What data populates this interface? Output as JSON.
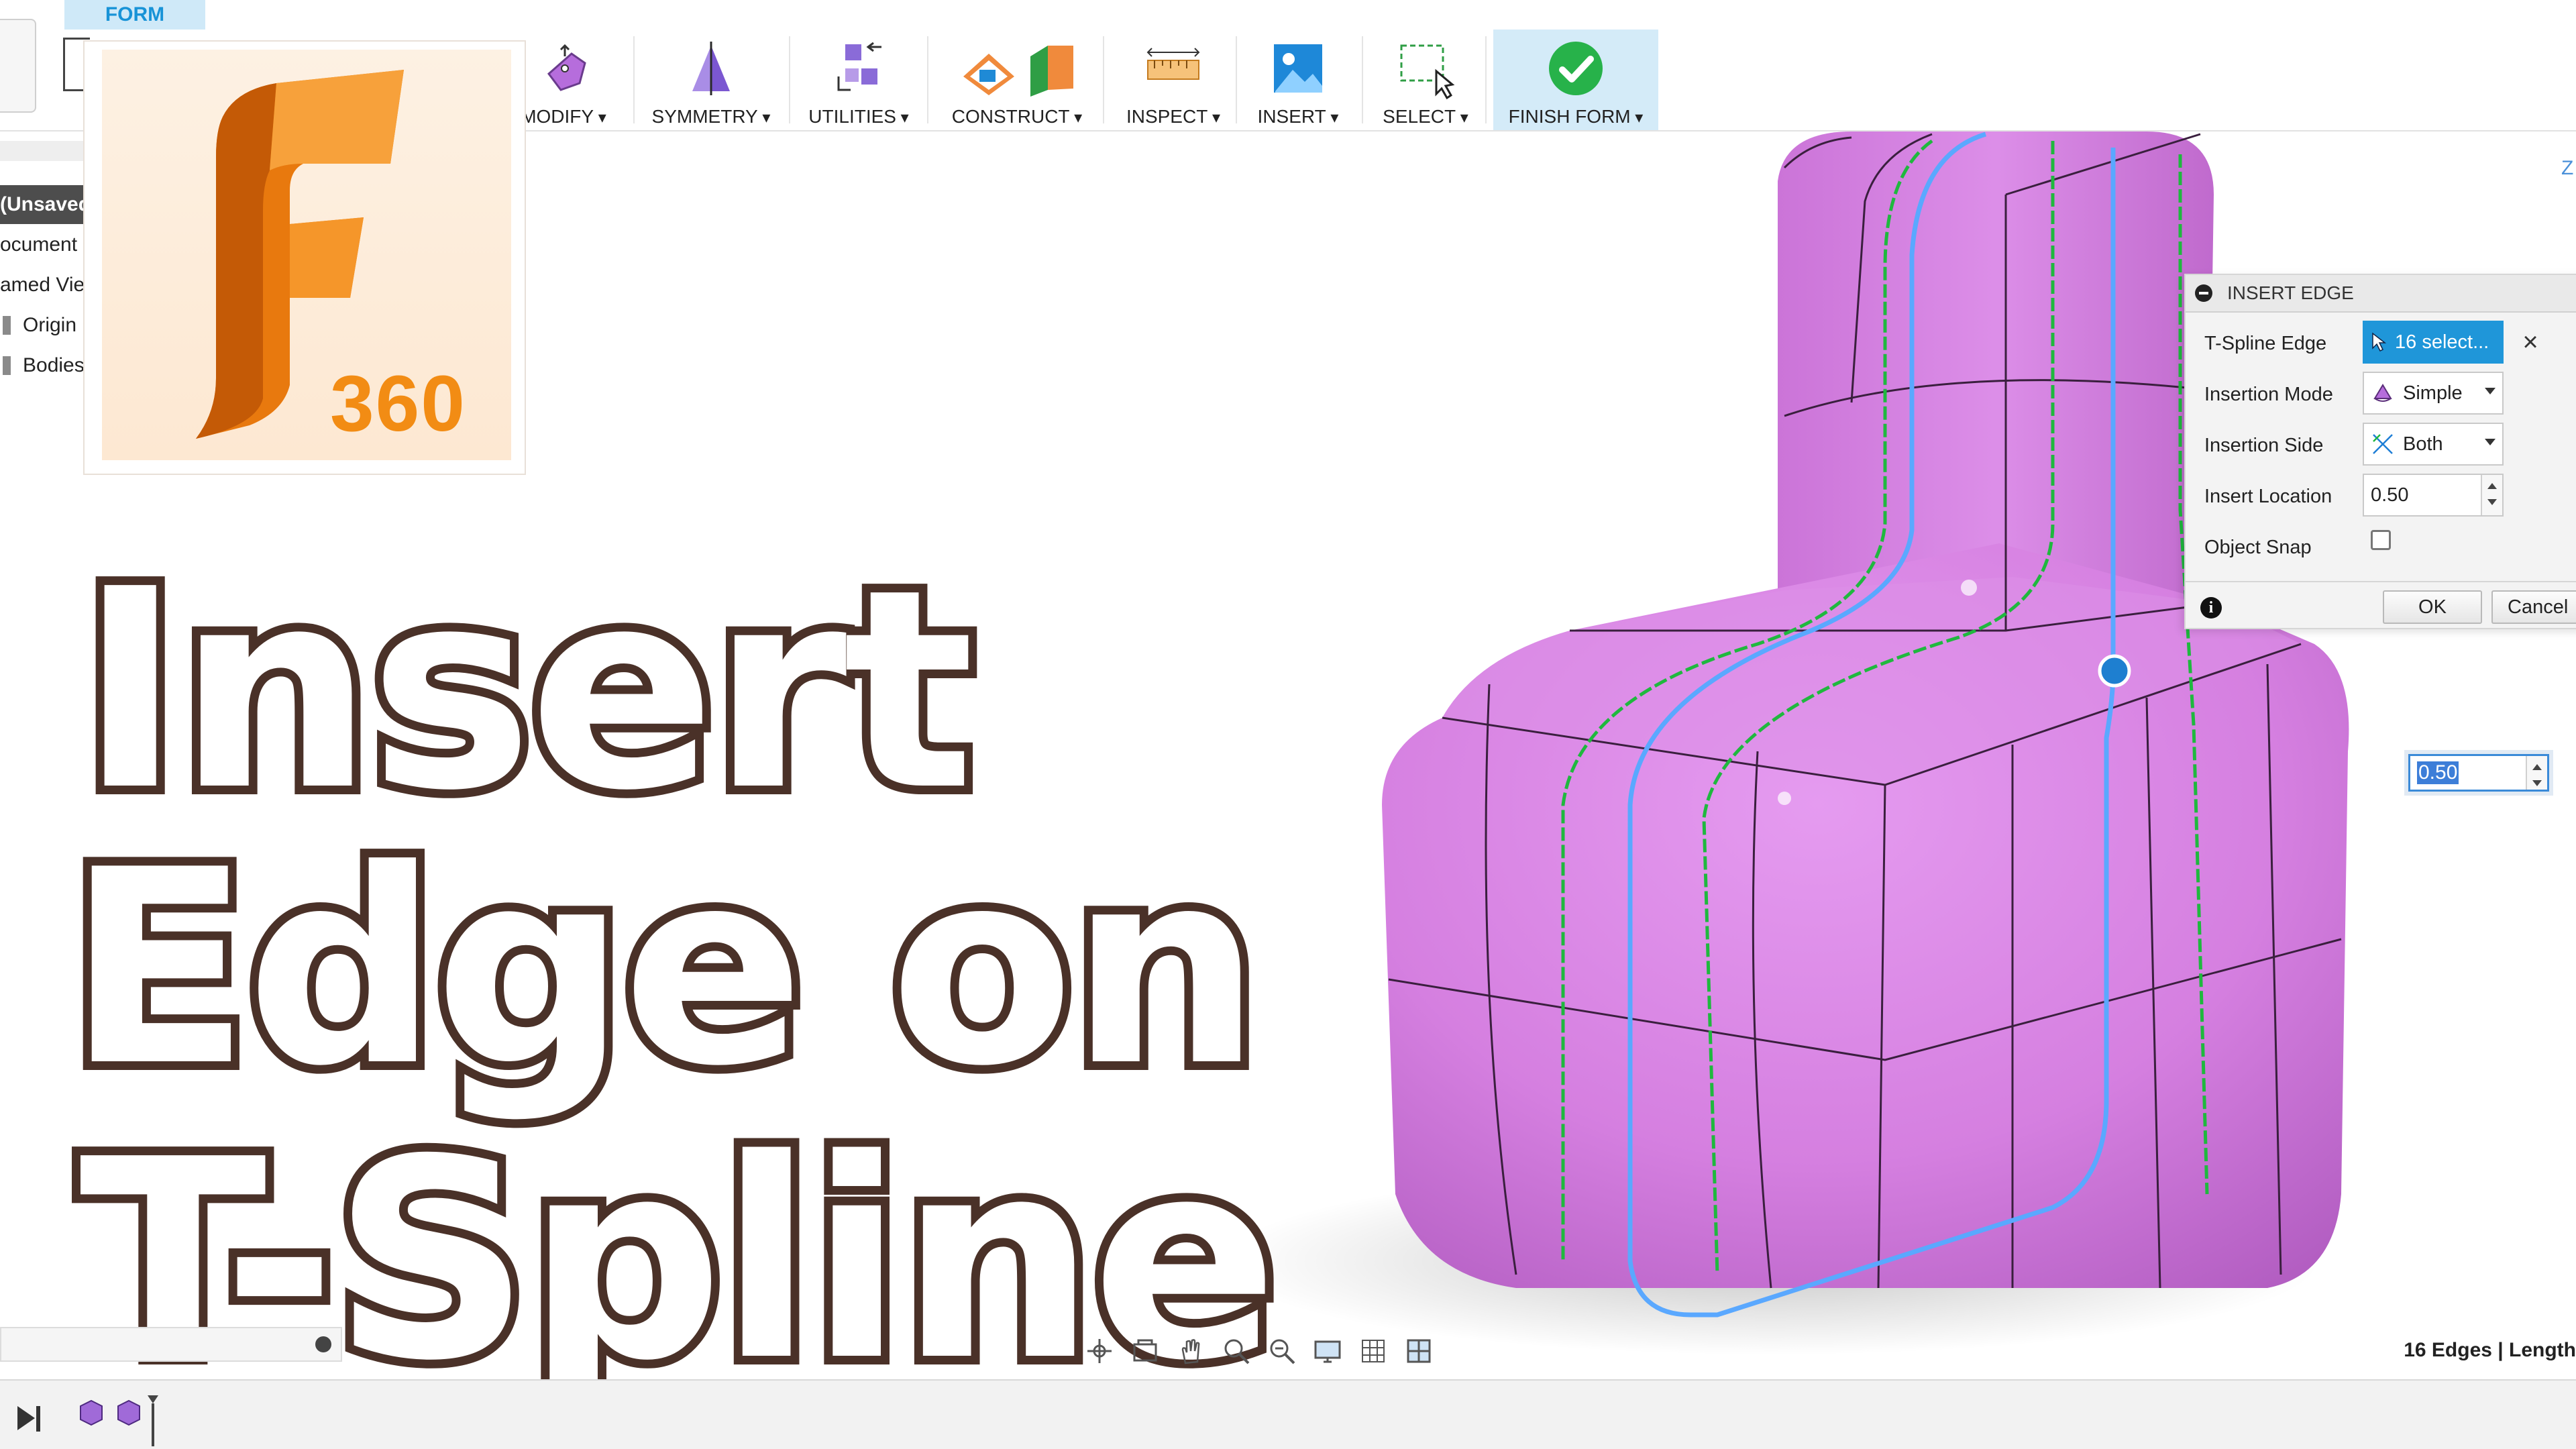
{
  "toolbar": {
    "active_tab": "FORM",
    "tools": [
      {
        "label": "MODIFY"
      },
      {
        "label": "SYMMETRY"
      },
      {
        "label": "UTILITIES"
      },
      {
        "label": "CONSTRUCT"
      },
      {
        "label": "INSPECT"
      },
      {
        "label": "INSERT"
      },
      {
        "label": "SELECT"
      },
      {
        "label": "FINISH FORM"
      }
    ]
  },
  "browser": {
    "items": [
      "(Unsaved",
      "ocument",
      "amed Vie",
      "Origin",
      "Bodies"
    ]
  },
  "logo": {
    "text": "360",
    "icon": "fusion-360-logo-icon"
  },
  "overlay_title": {
    "lines": [
      "Insert",
      "Edge on",
      "T-Spline"
    ]
  },
  "dialog": {
    "title": "INSERT EDGE",
    "rows": [
      {
        "label": "T-Spline Edge",
        "value": "16 select..."
      },
      {
        "label": "Insertion Mode",
        "value": "Simple"
      },
      {
        "label": "Insertion Side",
        "value": "Both"
      },
      {
        "label": "Insert Location",
        "value": "0.50"
      },
      {
        "label": "Object Snap",
        "value": ""
      }
    ],
    "ok_label": "OK",
    "cancel_label": "Cancel"
  },
  "viewport": {
    "floating_value": "0.50",
    "axis_label": "Z",
    "model_color": "#d57fe0",
    "selected_edge_color": "#5aa8ff",
    "new_edge_color": "#1fb83e"
  },
  "status": {
    "text": "16 Edges | Length"
  }
}
